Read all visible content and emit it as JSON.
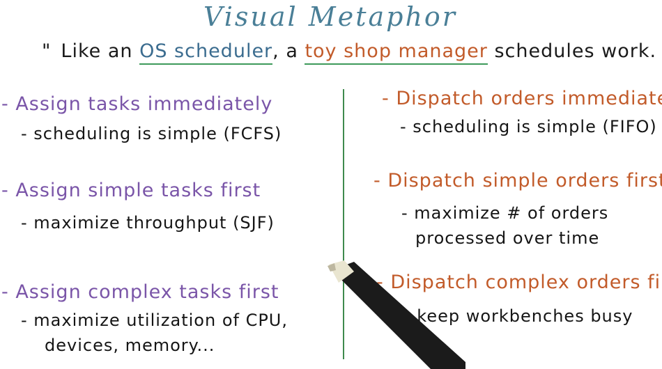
{
  "title": "Visual Metaphor",
  "subtitle": {
    "open_quote": "\"",
    "part1": "Like an ",
    "os_scheduler": "OS scheduler",
    "part2": ", a ",
    "toy_shop_manager": "toy shop manager",
    "part3": " schedules work.",
    "close_quote": "\""
  },
  "left": {
    "item1": {
      "main": "- Assign tasks immediately",
      "sub": "- scheduling is simple (FCFS)"
    },
    "item2": {
      "main": "- Assign simple tasks first",
      "sub": "- maximize throughput (SJF)"
    },
    "item3": {
      "main": "- Assign complex tasks first",
      "sub1": "- maximize utilization of CPU,",
      "sub2": "devices, memory..."
    }
  },
  "right": {
    "item1": {
      "main": "- Dispatch orders immediately",
      "sub": "- scheduling is simple (FIFO)"
    },
    "item2": {
      "main": "- Dispatch simple orders first",
      "sub1": "- maximize # of orders",
      "sub2": "processed over time"
    },
    "item3": {
      "main": "- Dispatch complex orders first",
      "sub": "- keep workbenches busy"
    }
  },
  "colors": {
    "title": "#4a7f97",
    "os_terms": "#7a55a8",
    "toy_terms": "#c25b2a",
    "divider": "#3f8a4d"
  }
}
